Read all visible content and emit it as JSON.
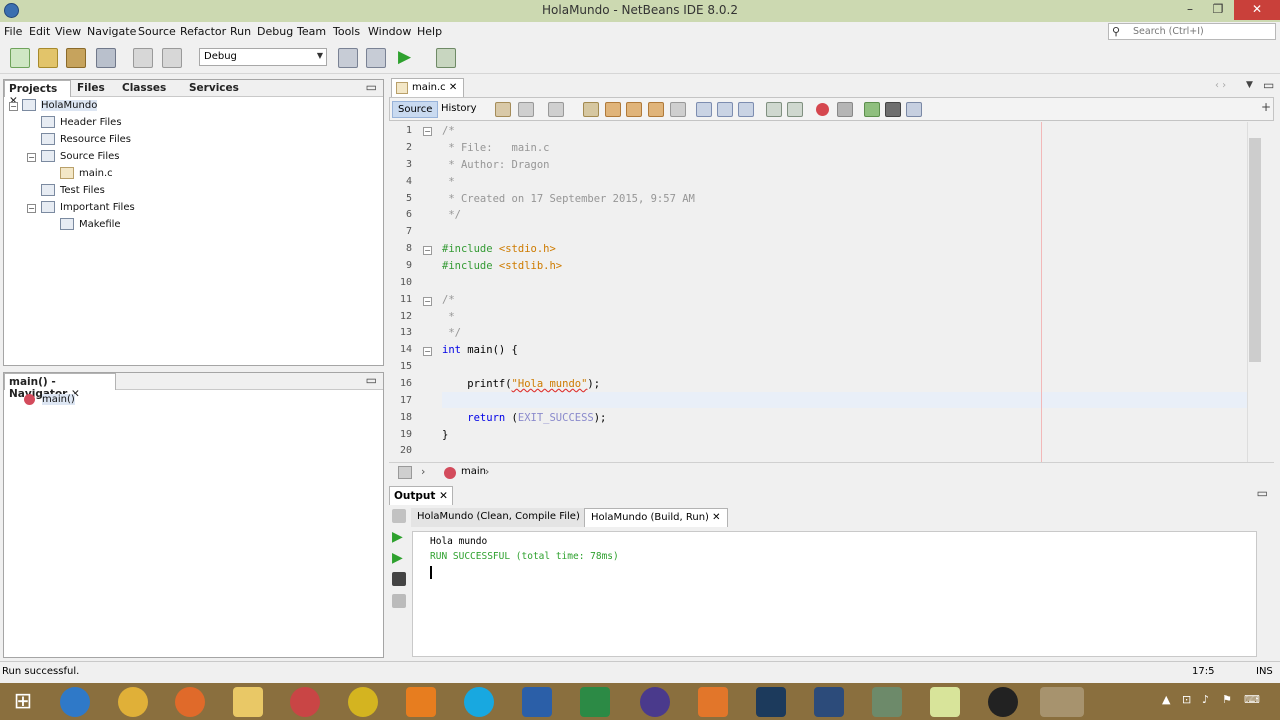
{
  "window": {
    "title": "HolaMundo - NetBeans IDE 8.0.2",
    "minimize": "–",
    "restore": "❐",
    "close": "✕"
  },
  "menu": [
    "File",
    "Edit",
    "View",
    "Navigate",
    "Source",
    "Refactor",
    "Run",
    "Debug",
    "Team",
    "Tools",
    "Window",
    "Help"
  ],
  "search": {
    "placeholder": "Search (Ctrl+I)"
  },
  "toolbar": {
    "config_value": "Debug"
  },
  "projects_panel": {
    "tabs": [
      "Projects",
      "Files",
      "Classes",
      "Services"
    ],
    "tree": {
      "root": "HolaMundo",
      "items": [
        "Header Files",
        "Resource Files",
        "Source Files",
        "main.c",
        "Test Files",
        "Important Files",
        "Makefile"
      ]
    }
  },
  "navigator": {
    "title": "main() - Navigator",
    "item": "main()"
  },
  "editor": {
    "tab": "main.c",
    "views": {
      "source": "Source",
      "history": "History"
    },
    "line_numbers": [
      "1",
      "2",
      "3",
      "4",
      "5",
      "6",
      "7",
      "8",
      "9",
      "10",
      "11",
      "12",
      "13",
      "14",
      "15",
      "16",
      "17",
      "18",
      "19",
      "20"
    ],
    "code": {
      "l1": "/*",
      "l2": " * File:   main.c",
      "l3": " * Author: Dragon",
      "l4": " *",
      "l5": " * Created on 17 September 2015, 9:57 AM",
      "l6": " */",
      "l8a": "#include ",
      "l8b": "<stdio.h>",
      "l9a": "#include ",
      "l9b": "<stdlib.h>",
      "l11": "/*",
      "l12": " *",
      "l13": " */",
      "l14a": "int",
      "l14b": " main() {",
      "l16a": "    printf(",
      "l16b": "\"Hola mundo\"",
      "l16c": ");",
      "l18a": "    return",
      "l18b": " (",
      "l18c": "EXIT_SUCCESS",
      "l18d": ");",
      "l19": "}"
    },
    "breadcrumb": "main"
  },
  "output": {
    "title": "Output",
    "tabs": [
      "HolaMundo (Clean, Compile File)",
      "HolaMundo (Build, Run)"
    ],
    "lines": [
      "Hola mundo",
      "RUN SUCCESSFUL (total time: 78ms)"
    ]
  },
  "status": {
    "message": "Run successful.",
    "caret": "17:5",
    "mode": "INS"
  },
  "colors": {
    "titlebar": "#ccd9b1",
    "taskbar": "#8a6f3e",
    "run_green": "#2ea12e"
  }
}
